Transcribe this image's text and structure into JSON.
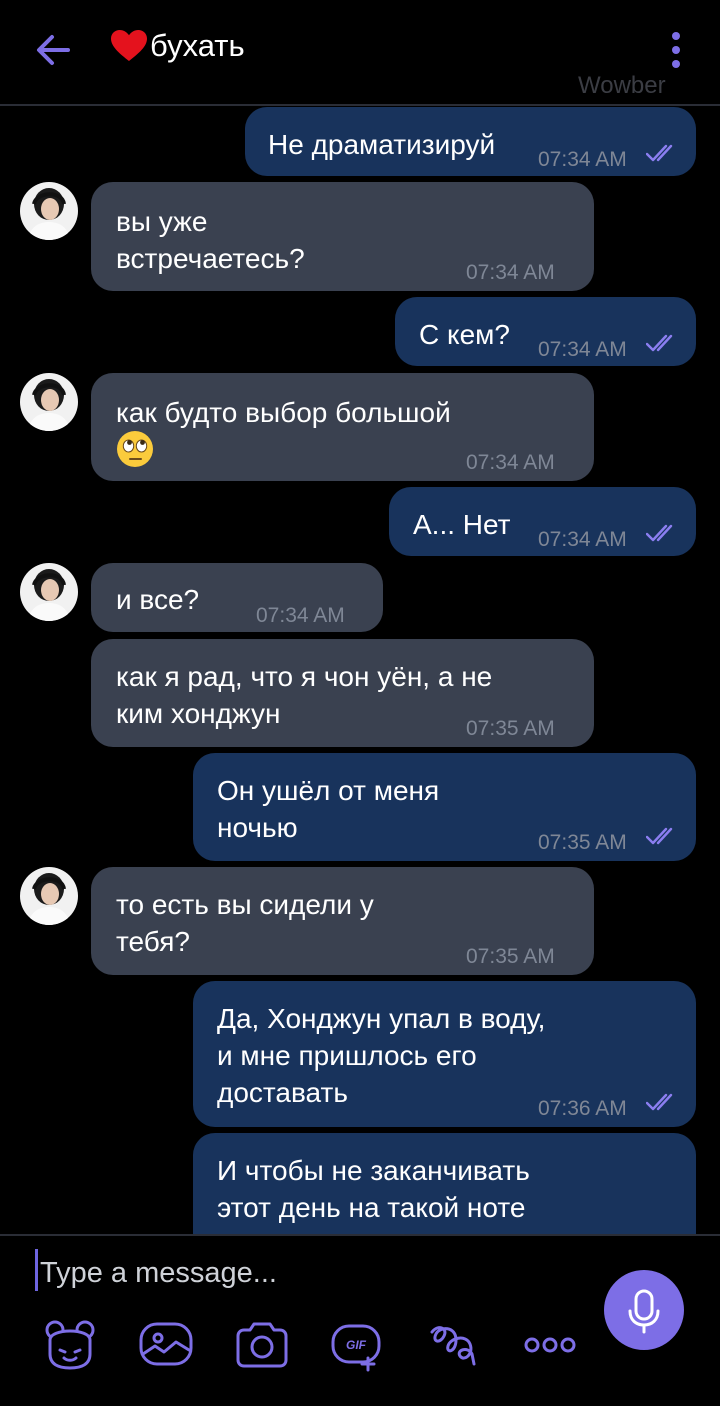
{
  "header": {
    "title": "бухать",
    "watermark": "Wowber",
    "accent_color": "#7d6ee6"
  },
  "messages": [
    {
      "dir": "out",
      "text": "Не драматизируй",
      "time": "07:34 AM",
      "read": true
    },
    {
      "dir": "in",
      "text": "вы уже\nвстречаетесь?",
      "time": "07:34 AM",
      "avatar": true
    },
    {
      "dir": "out",
      "text": "С кем?",
      "time": "07:34 AM",
      "read": true
    },
    {
      "dir": "in",
      "text": "как будто выбор большой",
      "emoji": "face-with-rolling-eyes",
      "time": "07:34 AM",
      "avatar": true
    },
    {
      "dir": "out",
      "text": "А... Нет",
      "time": "07:34 AM",
      "read": true
    },
    {
      "dir": "in",
      "text": "и все?",
      "time": "07:34 AM",
      "avatar": true
    },
    {
      "dir": "in",
      "text": "как я рад, что я чон уён, а не\nким хонджун",
      "time": "07:35 AM"
    },
    {
      "dir": "out",
      "text": "Он ушёл от меня\nночью",
      "time": "07:35 AM",
      "read": true
    },
    {
      "dir": "in",
      "text": "то есть вы сидели у\nтебя?",
      "time": "07:35 AM",
      "avatar": true
    },
    {
      "dir": "out",
      "text": "Да, Хонджун упал в воду,\nи мне пришлось его\nдоставать",
      "time": "07:36 AM",
      "read": true
    },
    {
      "dir": "out",
      "text": "И чтобы не заканчивать\nэтот день на такой ноте",
      "time": ""
    }
  ],
  "composer": {
    "placeholder": "Type a message...",
    "tools": [
      "sticker-icon",
      "image-icon",
      "camera-icon",
      "gif-icon",
      "doodle-icon",
      "more-icon"
    ]
  }
}
